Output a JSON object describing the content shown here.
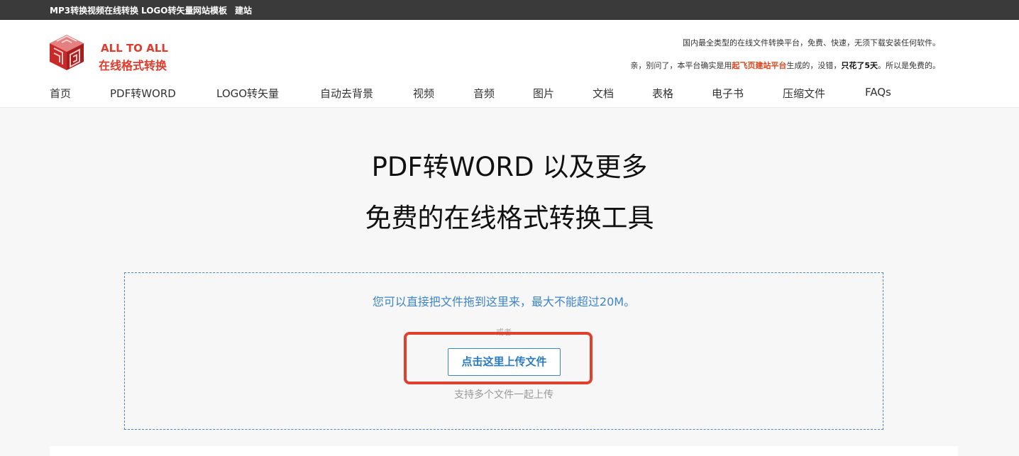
{
  "topbar": {
    "links": [
      "MP3转换",
      "视频在线转换",
      "LOGO转矢量",
      "网站模板",
      "建站"
    ]
  },
  "brand": {
    "line1": "ALL TO ALL",
    "line2": "在线格式转换",
    "color": "#e23a2c",
    "icon": "red-cube-logo-icon"
  },
  "tagline": {
    "line1": "国内最全类型的在线文件转换平台，免费、快速，无须下载安装任何软件。",
    "line2_pre": "亲，别问了，本平台确实是用",
    "line2_link": "起飞页建站平台",
    "line2_mid": "生成的，没错，",
    "line2_bold": "只花了5天",
    "line2_end": "。所以是免费的。"
  },
  "nav": {
    "items": [
      "首页",
      "PDF转WORD",
      "LOGO转矢量",
      "自动去背景",
      "视频",
      "音频",
      "图片",
      "文档",
      "表格",
      "电子书",
      "压缩文件",
      "FAQs"
    ]
  },
  "hero": {
    "line1": "PDF转WORD 以及更多",
    "line2": "免费的在线格式转换工具"
  },
  "upload": {
    "drop_hint": "您可以直接把文件拖到这里来，最大不能超过20M。",
    "or": "或者",
    "button": "点击这里上传文件",
    "multi": "支持多个文件一起上传"
  },
  "colors": {
    "accent_blue": "#3e84c6",
    "highlight_red": "#e0412f",
    "topbar_bg": "#3a3a3a"
  }
}
